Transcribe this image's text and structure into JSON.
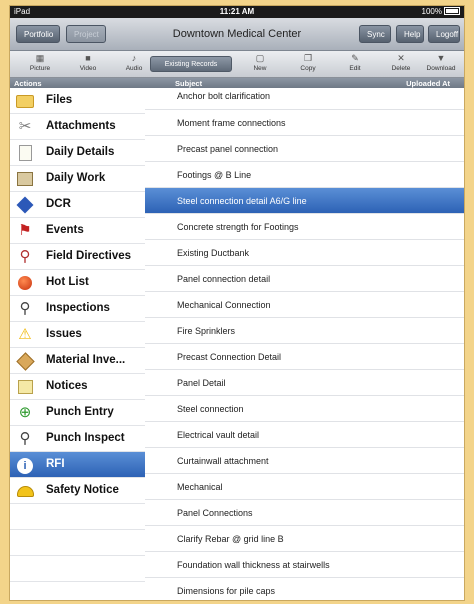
{
  "status": {
    "device": "iPad",
    "time": "11:21 AM",
    "battery": "100%"
  },
  "nav": {
    "title": "Downtown Medical Center",
    "portfolio": "Portfolio",
    "project": "Project",
    "sync": "Sync",
    "help": "Help",
    "logoff": "Logoff"
  },
  "toolbar": {
    "picture": "Picture",
    "video": "Video",
    "audio": "Audio",
    "existing": "Existing Records",
    "new": "New",
    "copy": "Copy",
    "edit": "Edit",
    "delete": "Delete",
    "download": "Download"
  },
  "headers": {
    "actions": "Actions",
    "subject": "Subject",
    "uploaded": "Uploaded At"
  },
  "sidebar": {
    "items": [
      {
        "label": "Files",
        "icon": "folder-icon"
      },
      {
        "label": "Attachments",
        "icon": "paperclip-icon"
      },
      {
        "label": "Daily Details",
        "icon": "document-icon"
      },
      {
        "label": "Daily Work",
        "icon": "book-icon"
      },
      {
        "label": "DCR",
        "icon": "diamond-icon"
      },
      {
        "label": "Events",
        "icon": "calendar-flag-icon"
      },
      {
        "label": "Field Directives",
        "icon": "pushpin-icon"
      },
      {
        "label": "Hot List",
        "icon": "red-ball-icon"
      },
      {
        "label": "Inspections",
        "icon": "magnifier-icon"
      },
      {
        "label": "Issues",
        "icon": "warning-icon"
      },
      {
        "label": "Material Inve...",
        "icon": "package-icon"
      },
      {
        "label": "Notices",
        "icon": "note-icon"
      },
      {
        "label": "Punch Entry",
        "icon": "punch-entry-icon"
      },
      {
        "label": "Punch Inspect",
        "icon": "punch-inspect-icon"
      },
      {
        "label": "RFI",
        "icon": "info-icon"
      },
      {
        "label": "Safety Notice",
        "icon": "hardhat-icon"
      }
    ],
    "selected_index": 14
  },
  "list": {
    "rows": [
      "Anchor bolt clarification",
      "Moment frame connections",
      "Precast panel connection",
      "Footings @ B Line",
      "Steel connection detail A6/G line",
      "Concrete strength for Footings",
      "Existing Ductbank",
      "Panel connection detail",
      "Mechanical Connection",
      "Fire Sprinklers",
      "Precast Connection Detail",
      "Panel Detail",
      "Steel connection",
      "Electrical vault detail",
      "Curtainwall attachment",
      "Mechanical",
      "Panel Connections",
      "Clarify Rebar @ grid line B",
      "Foundation wall thickness at stairwells",
      "Dimensions for pile caps"
    ],
    "selected_index": 4
  },
  "colors": {
    "selection": "#3a6fc0",
    "background": "#f3d48a"
  }
}
